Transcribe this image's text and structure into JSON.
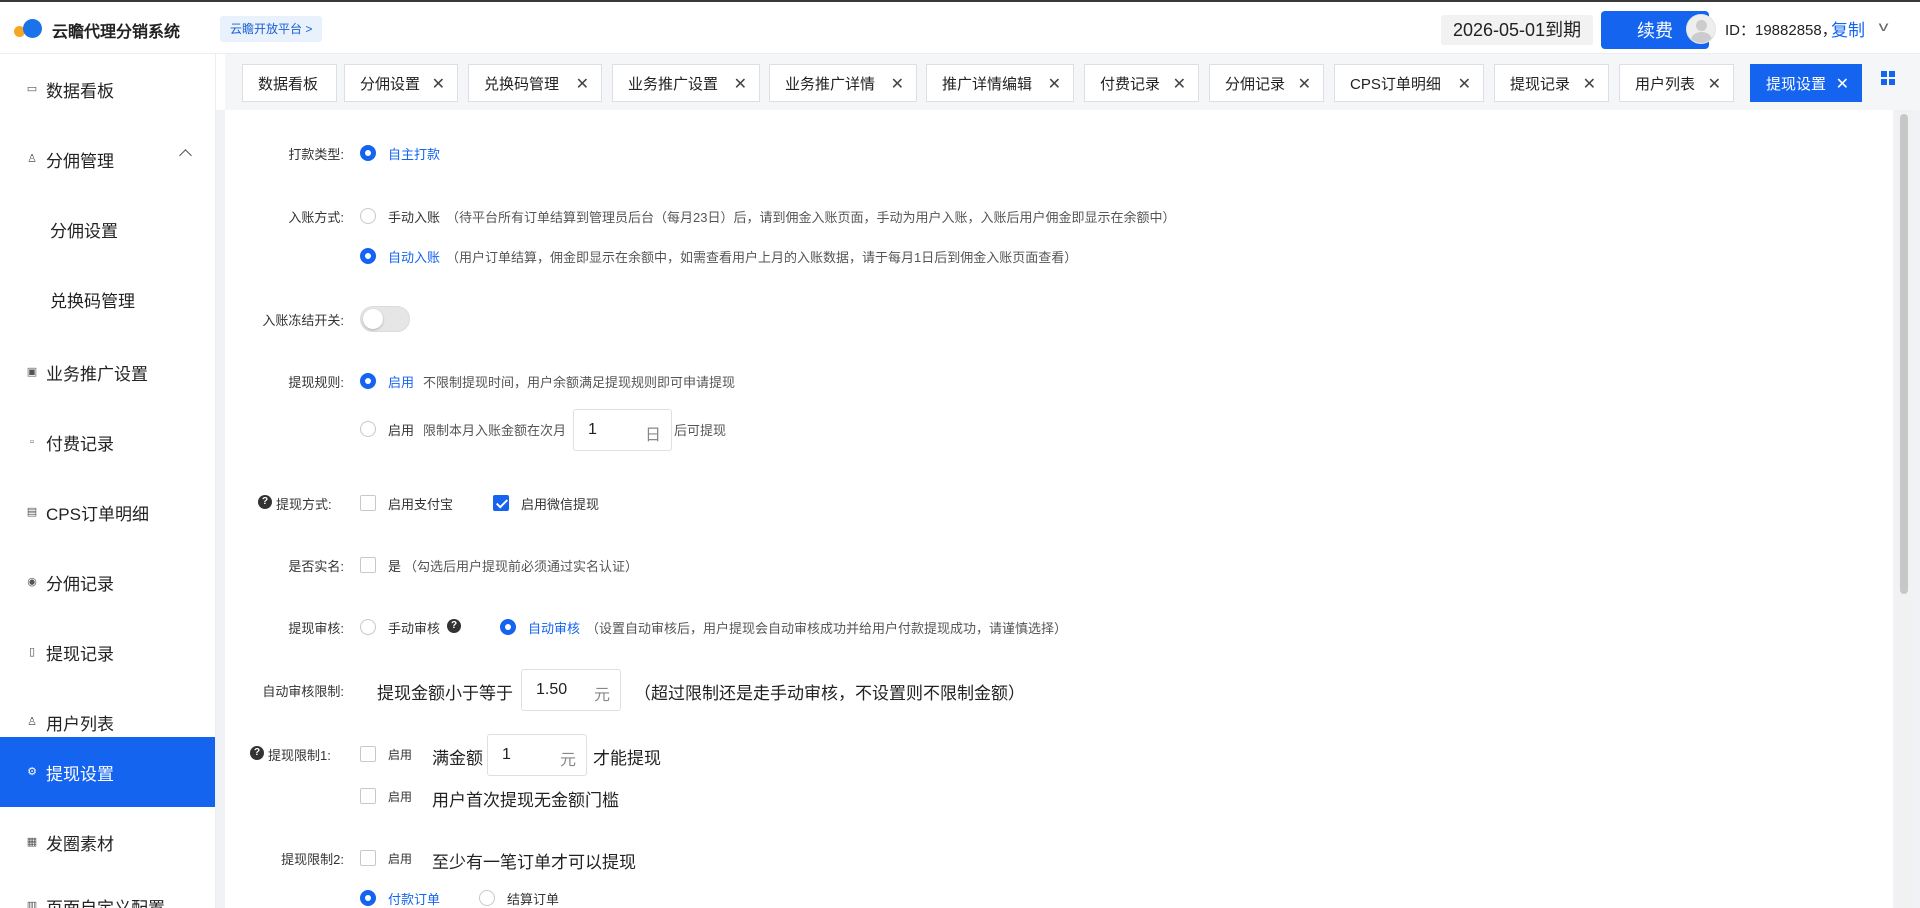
{
  "header": {
    "brand": "云瞻代理分销系统",
    "platform_tag": "云瞻开放平台 >",
    "expire": "2026-05-01到期",
    "renew": "续费",
    "uid": "ID：19882858，",
    "copy": "复制"
  },
  "sidebar": {
    "items": [
      {
        "label": "数据看板"
      },
      {
        "label": "分佣管理"
      },
      {
        "label": "分佣设置"
      },
      {
        "label": "兑换码管理"
      },
      {
        "label": "业务推广设置"
      },
      {
        "label": "付费记录"
      },
      {
        "label": "CPS订单明细"
      },
      {
        "label": "分佣记录"
      },
      {
        "label": "提现记录"
      },
      {
        "label": "用户列表"
      },
      {
        "label": "提现设置"
      },
      {
        "label": "发圈素材"
      },
      {
        "label": "页面自定义配置"
      }
    ]
  },
  "tabs": [
    {
      "label": "数据看板"
    },
    {
      "label": "分佣设置"
    },
    {
      "label": "兑换码管理"
    },
    {
      "label": "业务推广设置"
    },
    {
      "label": "业务推广详情"
    },
    {
      "label": "推广详情编辑"
    },
    {
      "label": "付费记录"
    },
    {
      "label": "分佣记录"
    },
    {
      "label": "CPS订单明细"
    },
    {
      "label": "提现记录"
    },
    {
      "label": "用户列表"
    },
    {
      "label": "提现设置"
    }
  ],
  "form": {
    "pay_type": {
      "label": "打款类型:",
      "option": "自主打款"
    },
    "entry_mode": {
      "label": "入账方式:",
      "manual": "手动入账",
      "manual_desc": "（待平台所有订单结算到管理员后台（每月23日）后，请到佣金入账页面，手动为用户入账，入账后用户佣金即显示在余额中）",
      "auto": "自动入账",
      "auto_desc": "（用户订单结算，佣金即显示在余额中，如需查看用户上月的入账数据，请于每月1日后到佣金入账页面查看）"
    },
    "freeze": {
      "label": "入账冻结开关:",
      "on": false
    },
    "rule": {
      "label": "提现规则:",
      "opt1": "启用",
      "opt1_desc": "不限制提现时间，用户余额满足提现规则即可申请提现",
      "opt2": "启用",
      "opt2_pre": "限制本月入账金额在次月",
      "opt2_value": "1",
      "opt2_unit": "日",
      "opt2_post": "后可提现"
    },
    "method": {
      "label": "提现方式:",
      "alipay": "启用支付宝",
      "wechat": "启用微信提现"
    },
    "realname": {
      "label": "是否实名:",
      "yes": "是",
      "desc": "（勾选后用户提现前必须通过实名认证）"
    },
    "review": {
      "label": "提现审核:",
      "manual": "手动审核",
      "auto": "自动审核",
      "auto_desc": "（设置自动审核后，用户提现会自动审核成功并给用户付款提现成功，请谨慎选择）"
    },
    "auto_limit": {
      "label": "自动审核限制:",
      "pre": "提现金额小于等于",
      "value": "1.50",
      "unit": "元",
      "post": "（超过限制还是走手动审核，不设置则不限制金额）"
    },
    "limit1": {
      "label": "提现限制1:",
      "enable": "启用",
      "pre": "满金额",
      "value": "1",
      "unit": "元",
      "post": "才能提现",
      "enable2": "启用",
      "first_free": "用户首次提现无金额门槛"
    },
    "limit2": {
      "label": "提现限制2:",
      "enable": "启用",
      "desc": "至少有一笔订单才可以提现",
      "paid": "付款订单",
      "settled": "结算订单"
    }
  },
  "colors": {
    "primary": "#1464f0",
    "accent_orange": "#f5a623"
  }
}
